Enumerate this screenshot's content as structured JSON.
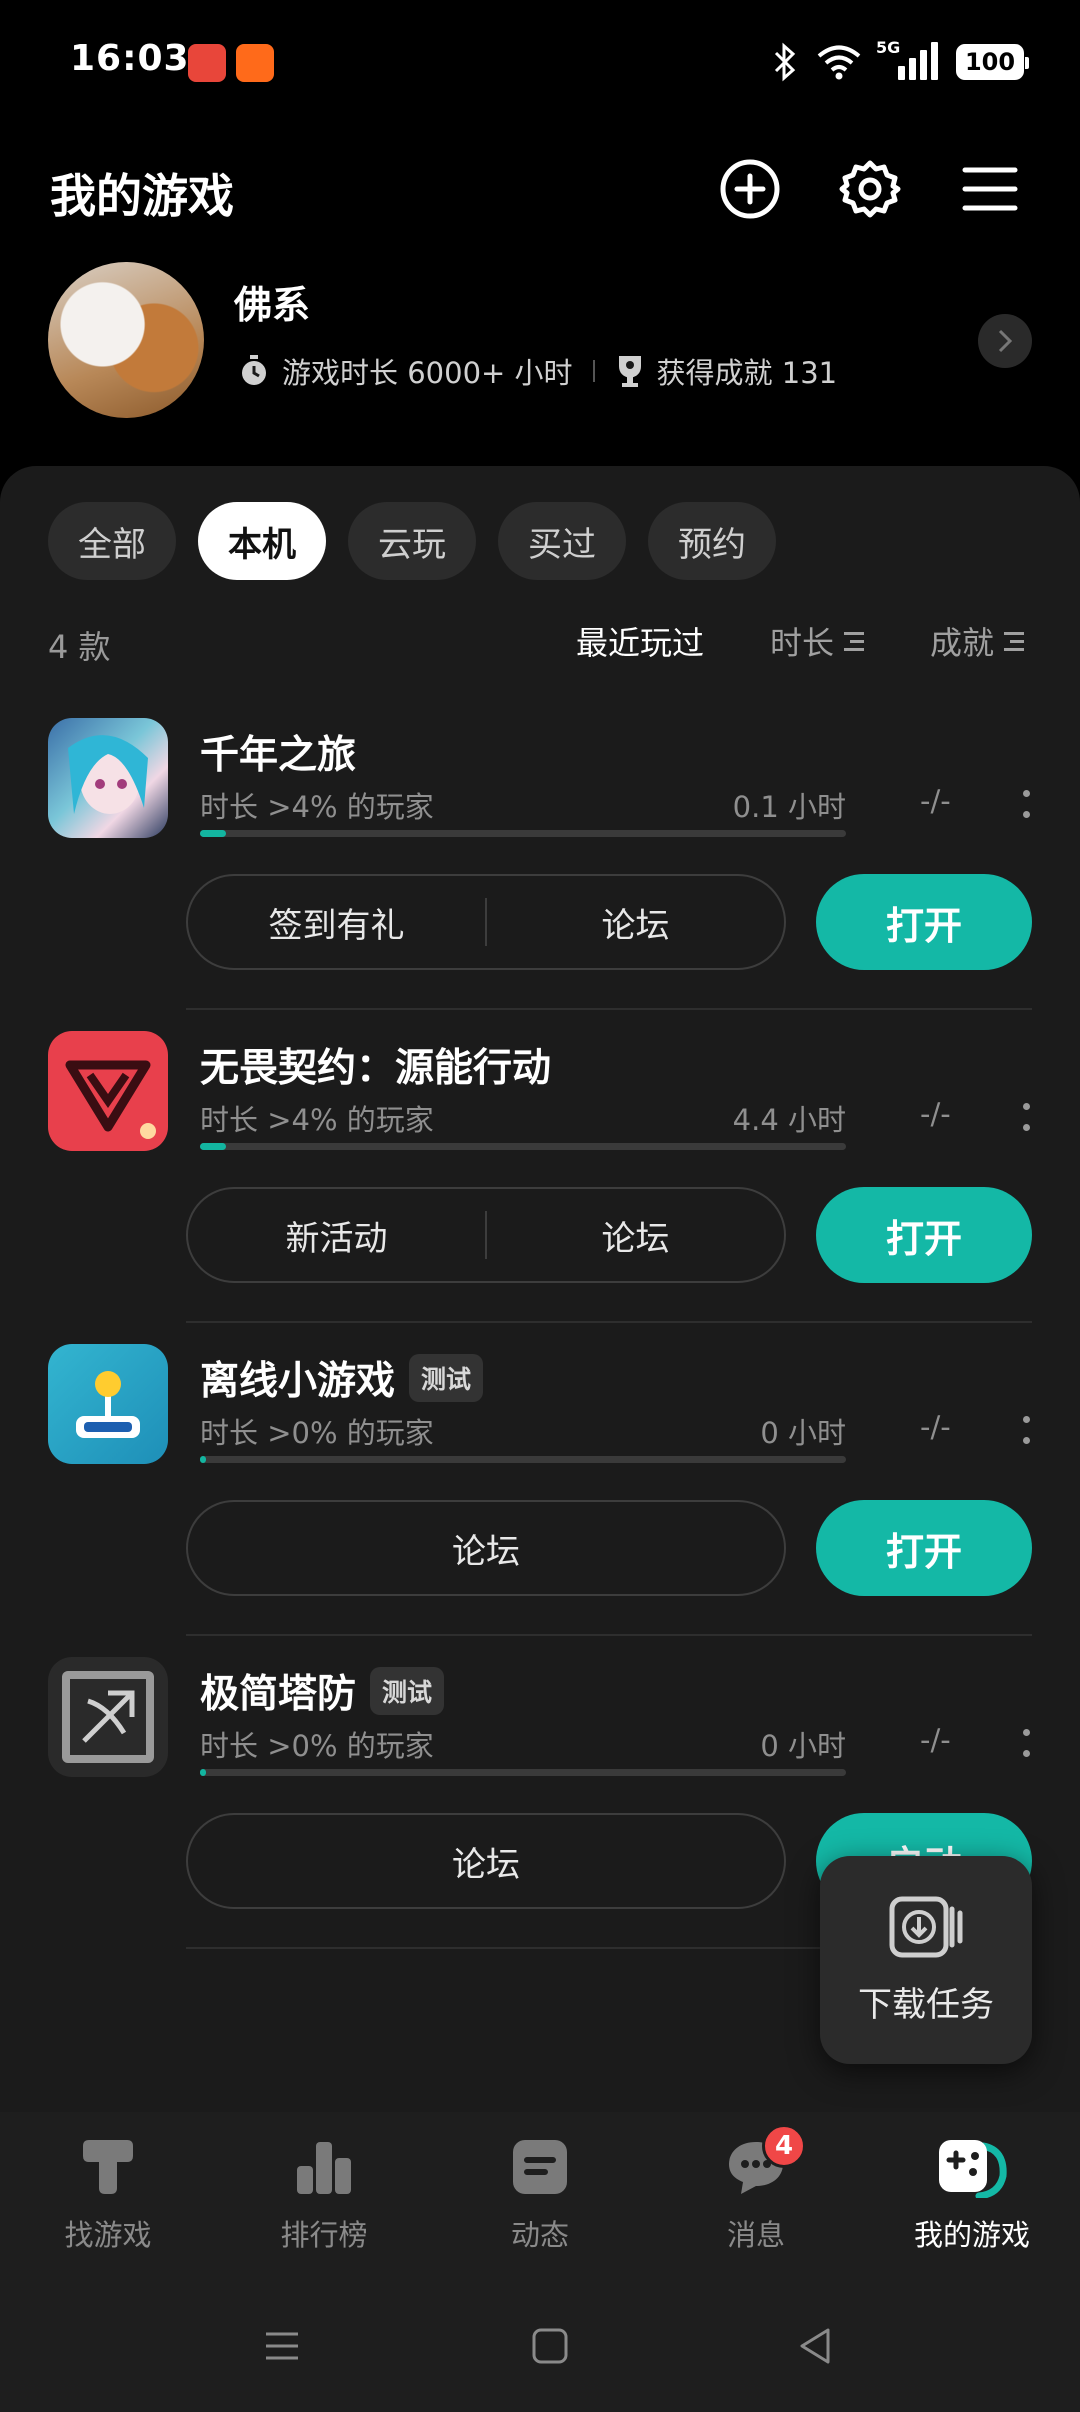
{
  "status_bar": {
    "time": "16:03",
    "network": "5G",
    "battery": "100"
  },
  "header": {
    "title": "我的游戏",
    "add_icon": "plus-circle-icon",
    "settings_icon": "gear-icon",
    "menu_icon": "hamburger-menu-icon"
  },
  "profile": {
    "name": "佛系",
    "playtime": "游戏时长 6000+ 小时",
    "achievements": "获得成就 131"
  },
  "tabs": [
    {
      "label": "全部",
      "active": false
    },
    {
      "label": "本机",
      "active": true
    },
    {
      "label": "云玩",
      "active": false
    },
    {
      "label": "买过",
      "active": false
    },
    {
      "label": "预约",
      "active": false
    }
  ],
  "list": {
    "count": "4 款",
    "sort_recent": "最近玩过",
    "sort_duration": "时长",
    "sort_achievement": "成就"
  },
  "games": [
    {
      "name": "千年之旅",
      "badge": "",
      "subtitle": "时长 >4% 的玩家",
      "hours": "0.1 小时",
      "achievement": "-/-",
      "progress": 0.04,
      "action1": "签到有礼",
      "action2": "论坛",
      "button": "打开"
    },
    {
      "name": "无畏契约：源能行动",
      "badge": "",
      "subtitle": "时长 >4% 的玩家",
      "hours": "4.4 小时",
      "achievement": "-/-",
      "progress": 0.04,
      "action1": "新活动",
      "action2": "论坛",
      "button": "打开"
    },
    {
      "name": "离线小游戏",
      "badge": "测试",
      "subtitle": "时长 >0% 的玩家",
      "hours": "0 小时",
      "achievement": "-/-",
      "progress": 0.0,
      "action1": "",
      "action2": "论坛",
      "button": "打开"
    },
    {
      "name": "极简塔防",
      "badge": "测试",
      "subtitle": "时长 >0% 的玩家",
      "hours": "0 小时",
      "achievement": "-/-",
      "progress": 0.0,
      "action1": "",
      "action2": "论坛",
      "button": "启动"
    }
  ],
  "download_task": {
    "label": "下载任务"
  },
  "bottom_nav": [
    {
      "label": "找游戏",
      "active": false
    },
    {
      "label": "排行榜",
      "active": false
    },
    {
      "label": "动态",
      "active": false
    },
    {
      "label": "消息",
      "active": false,
      "badge": "4"
    },
    {
      "label": "我的游戏",
      "active": true
    }
  ],
  "colors": {
    "accent": "#14b8a6",
    "background": "#000000",
    "panel": "#1b1b1b",
    "badge_red": "#f04747"
  }
}
